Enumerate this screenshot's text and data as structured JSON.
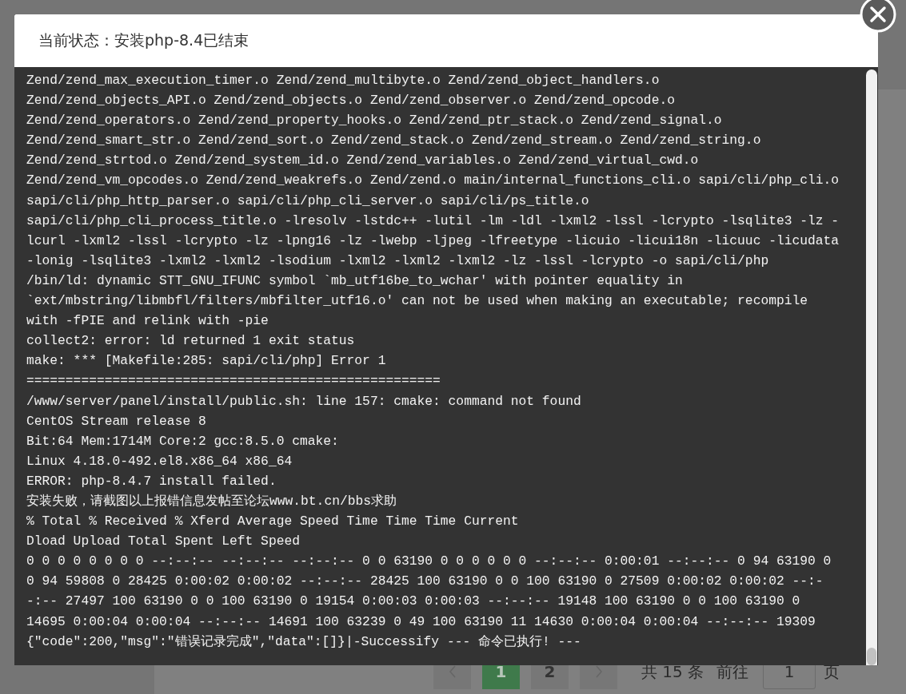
{
  "background": {
    "pagination": {
      "pages": [
        {
          "label": "1",
          "selected": true
        },
        {
          "label": "2",
          "selected": false
        }
      ],
      "total": "共 15 条",
      "goto_label": "前往",
      "goto_value": "1",
      "goto_suffix": "页"
    }
  },
  "dialog": {
    "title": "当前状态：安装php-8.4已结束",
    "log_lines": [
      "Zend/zend_max_execution_timer.o Zend/zend_multibyte.o Zend/zend_object_handlers.o",
      "Zend/zend_objects_API.o Zend/zend_objects.o Zend/zend_observer.o Zend/zend_opcode.o",
      "Zend/zend_operators.o Zend/zend_property_hooks.o Zend/zend_ptr_stack.o Zend/zend_signal.o",
      "Zend/zend_smart_str.o Zend/zend_sort.o Zend/zend_stack.o Zend/zend_stream.o Zend/zend_string.o",
      "Zend/zend_strtod.o Zend/zend_system_id.o Zend/zend_variables.o Zend/zend_virtual_cwd.o",
      "Zend/zend_vm_opcodes.o Zend/zend_weakrefs.o Zend/zend.o main/internal_functions_cli.o sapi/cli/php_cli.o",
      "sapi/cli/php_http_parser.o sapi/cli/php_cli_server.o sapi/cli/ps_title.o",
      "sapi/cli/php_cli_process_title.o -lresolv -lstdc++ -lutil -lm -ldl -lxml2 -lssl -lcrypto -lsqlite3 -lz -",
      "lcurl -lxml2 -lssl -lcrypto -lz -lpng16 -lz -lwebp -ljpeg -lfreetype -licuio -licui18n -licuuc -licudata",
      "-lonig -lsqlite3 -lxml2 -lxml2 -lsodium -lxml2 -lxml2 -lxml2 -lz -lssl -lcrypto -o sapi/cli/php",
      "/bin/ld: dynamic STT_GNU_IFUNC symbol `mb_utf16be_to_wchar' with pointer equality in",
      "`ext/mbstring/libmbfl/filters/mbfilter_utf16.o' can not be used when making an executable; recompile",
      "with -fPIE and relink with -pie",
      "collect2: error: ld returned 1 exit status",
      "make: *** [Makefile:285: sapi/cli/php] Error 1",
      "=====================================================",
      "/www/server/panel/install/public.sh: line 157: cmake: command not found",
      "CentOS Stream release 8",
      "Bit:64 Mem:1714M Core:2 gcc:8.5.0 cmake:",
      "Linux 4.18.0-492.el8.x86_64 x86_64",
      "ERROR: php-8.4.7 install failed.",
      "安装失败，请截图以上报错信息发帖至论坛www.bt.cn/bbs求助",
      "% Total % Received % Xferd Average Speed Time Time Time Current",
      "Dload Upload Total Spent Left Speed",
      "0 0 0 0 0 0 0 0 --:--:-- --:--:-- --:--:-- 0 0 63190 0 0 0 0 0 0 --:--:-- 0:00:01 --:--:-- 0 94 63190 0",
      "0 94 59808 0 28425 0:00:02 0:00:02 --:--:-- 28425 100 63190 0 0 100 63190 0 27509 0:00:02 0:00:02 --:-",
      "-:-- 27497 100 63190 0 0 100 63190 0 19154 0:00:03 0:00:03 --:--:-- 19148 100 63190 0 0 100 63190 0",
      "14695 0:00:04 0:00:04 --:--:-- 14691 100 63239 0 49 100 63190 11 14630 0:00:04 0:00:04 --:--:-- 19309",
      "{\"code\":200,\"msg\":\"错误记录完成\",\"data\":[]}|-Successify --- 命令已执行! ---"
    ]
  }
}
